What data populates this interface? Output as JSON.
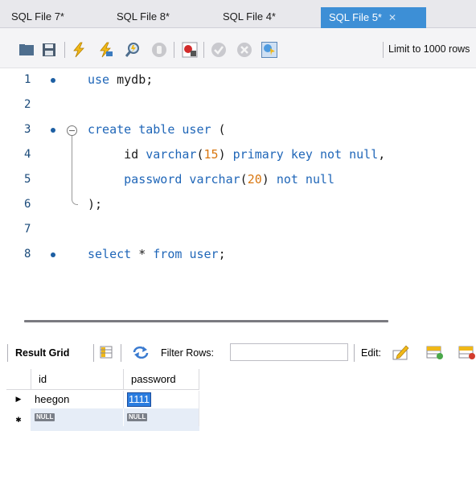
{
  "tabs": [
    {
      "label": "SQL File 7*",
      "active": false
    },
    {
      "label": "SQL File 8*",
      "active": false
    },
    {
      "label": "SQL File 4*",
      "active": false
    },
    {
      "label": "SQL File 5*",
      "active": true
    }
  ],
  "toolbar": {
    "icons": [
      "folder-open-icon",
      "save-icon",
      "execute-icon",
      "execute-current-icon",
      "explain-icon",
      "stop-icon",
      "toggle-error-icon",
      "commit-icon",
      "rollback-icon",
      "autocommit-icon"
    ],
    "limit_label": "Limit to 1000 rows"
  },
  "editor": {
    "lines": [
      {
        "number": "1",
        "has_dot": true,
        "code": "use mydb;"
      },
      {
        "number": "2",
        "has_dot": false,
        "code": ""
      },
      {
        "number": "3",
        "has_dot": true,
        "code": "create table user ("
      },
      {
        "number": "4",
        "has_dot": false,
        "code": "    id varchar(15) primary key not null,"
      },
      {
        "number": "5",
        "has_dot": false,
        "code": "    password varchar(20) not null"
      },
      {
        "number": "6",
        "has_dot": false,
        "code": ");"
      },
      {
        "number": "7",
        "has_dot": false,
        "code": ""
      },
      {
        "number": "8",
        "has_dot": true,
        "code": "select * from user;"
      }
    ]
  },
  "result": {
    "grid_label": "Result Grid",
    "filter_label": "Filter Rows:",
    "filter_value": "",
    "edit_label": "Edit:",
    "columns": [
      "id",
      "password"
    ],
    "rows": [
      {
        "indicator": "▶",
        "id": "heegon",
        "password": "1111"
      },
      {
        "indicator": "✱",
        "id": "NULL",
        "password": "NULL"
      }
    ]
  }
}
